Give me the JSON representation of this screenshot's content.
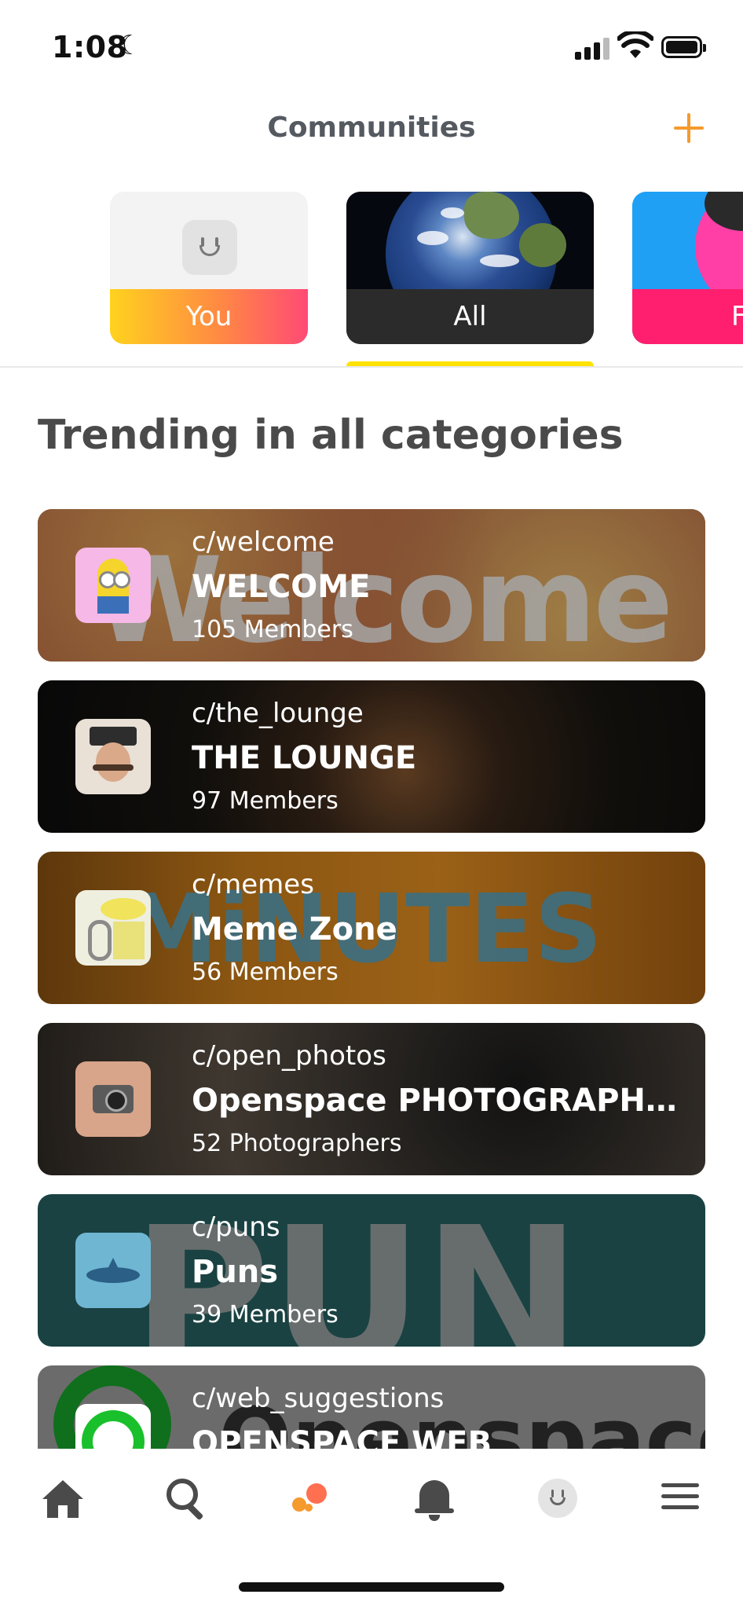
{
  "status_bar": {
    "time": "1:08"
  },
  "header": {
    "title": "Communities"
  },
  "category_tabs": [
    {
      "label": "You",
      "selected": false
    },
    {
      "label": "All",
      "selected": true
    },
    {
      "label": "F",
      "selected": false
    }
  ],
  "section": {
    "title": "Trending in all categories"
  },
  "communities": [
    {
      "handle": "c/welcome",
      "name": "WELCOME",
      "members": "105 Members",
      "bg_word": "Welcome"
    },
    {
      "handle": "c/the_lounge",
      "name": "THE LOUNGE",
      "members": "97 Members"
    },
    {
      "handle": "c/memes",
      "name": "Meme Zone",
      "members": "56 Members",
      "bg_word": "MiNUTES"
    },
    {
      "handle": "c/open_photos",
      "name": "Openspace PHOTOGRAPH...",
      "members": "52 Photographers"
    },
    {
      "handle": "c/puns",
      "name": "Puns",
      "members": "39 Members",
      "bg_word": "PUN"
    },
    {
      "handle": "c/web_suggestions",
      "name": "OPENSPACE WEB",
      "bg_word": "Openspace"
    }
  ],
  "bottom_nav": [
    {
      "icon": "home-icon"
    },
    {
      "icon": "search-icon"
    },
    {
      "icon": "communities-icon",
      "active": true
    },
    {
      "icon": "bell-icon"
    },
    {
      "icon": "profile-icon"
    },
    {
      "icon": "menu-icon"
    }
  ],
  "colors": {
    "accent": "#f59a2d",
    "tab_indicator": "#ffe200",
    "title_text": "#4a4a4a"
  }
}
